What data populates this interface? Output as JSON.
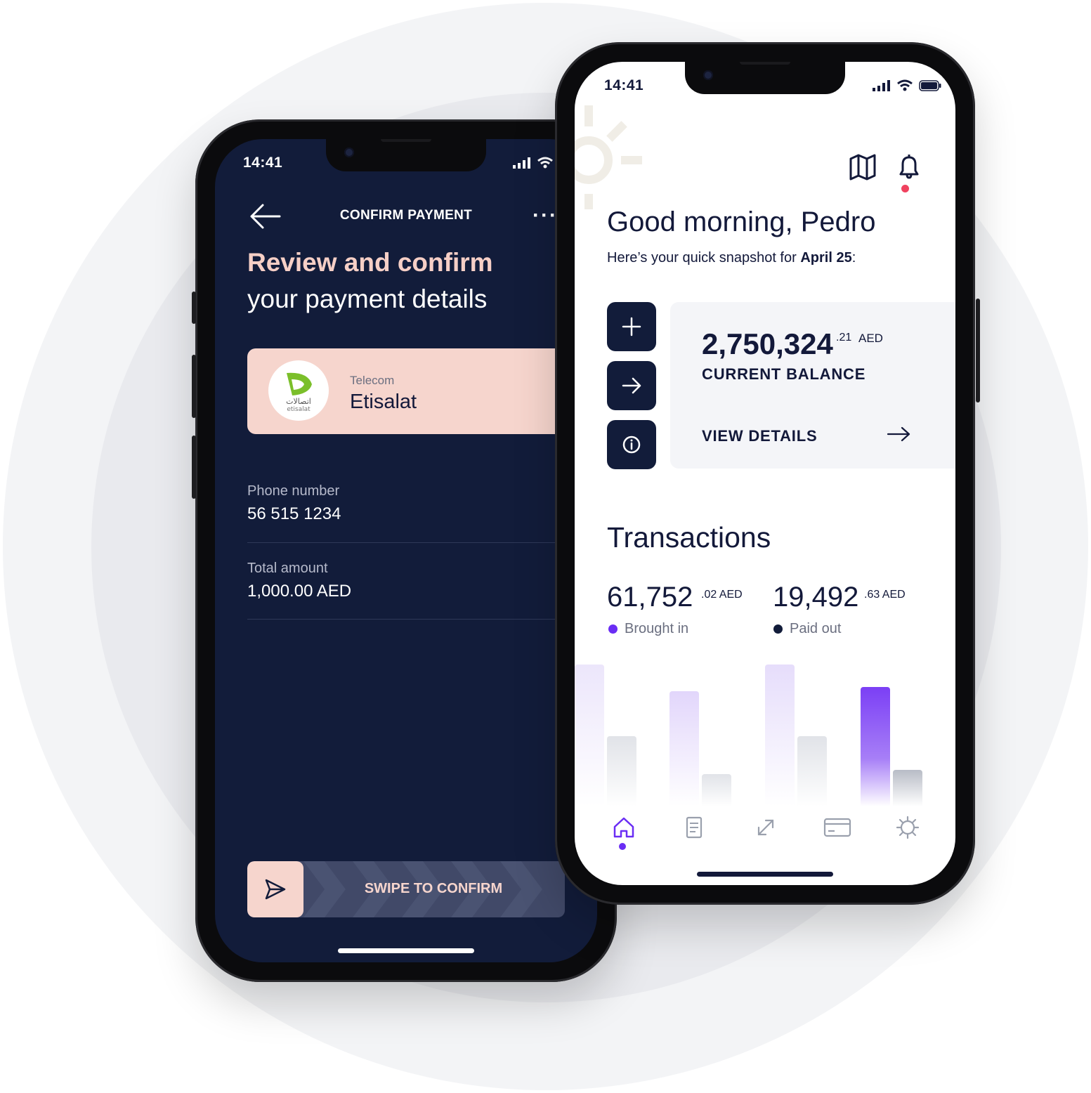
{
  "left_phone": {
    "time": "14:41",
    "header": {
      "title": "CONFIRM PAYMENT",
      "more": "···"
    },
    "heading": {
      "line1": "Review and confirm",
      "line2": "your payment details"
    },
    "biller": {
      "category": "Telecom",
      "name": "Etisalat",
      "logo_text_arabic": "اتصالات",
      "logo_text_latin": "etisalat"
    },
    "fields": [
      {
        "label": "Phone number",
        "value": "56 515 1234"
      },
      {
        "label": "Total amount",
        "value": "1,000.00 AED"
      }
    ],
    "swipe_label": "SWIPE TO CONFIRM"
  },
  "right_phone": {
    "time": "14:41",
    "greeting": "Good morning, Pedro",
    "snapshot_prefix": "Here’s your quick snapshot for ",
    "snapshot_date": "April 25",
    "snapshot_suffix": ":",
    "balance": {
      "whole": "2,750,324",
      "decimal": ".21",
      "currency": "AED",
      "label": "CURRENT BALANCE",
      "link": "VIEW DETAILS"
    },
    "transactions": {
      "title": "Transactions",
      "brought_in": {
        "whole": "61,752",
        "decimal": ".02 AED",
        "label": "Brought in",
        "color": "#6a2df4"
      },
      "paid_out": {
        "whole": "19,492",
        "decimal": ".63 AED",
        "label": "Paid out",
        "color": "#121c3a"
      }
    },
    "tabs": [
      "home-icon",
      "document-icon",
      "transfer-icon",
      "card-icon",
      "settings-icon"
    ]
  },
  "colors": {
    "navy": "#121c3a",
    "peach": "#f6d5cd",
    "purple": "#6a2df4",
    "alert": "#f0425f"
  }
}
